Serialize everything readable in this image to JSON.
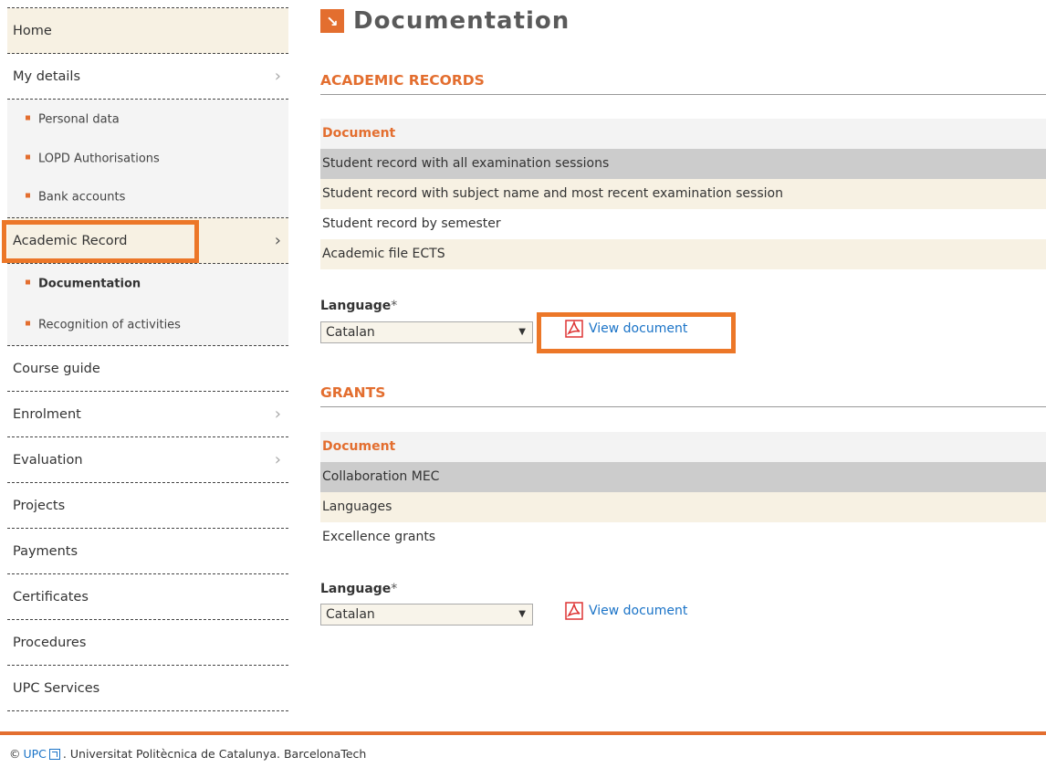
{
  "sidebar": {
    "items": [
      {
        "label": "Home"
      },
      {
        "label": "My details"
      },
      {
        "label": "Personal data"
      },
      {
        "label": "LOPD Authorisations"
      },
      {
        "label": "Bank accounts"
      },
      {
        "label": "Academic Record"
      },
      {
        "label": "Documentation"
      },
      {
        "label": "Recognition of activities"
      },
      {
        "label": "Course guide"
      },
      {
        "label": "Enrolment"
      },
      {
        "label": "Evaluation"
      },
      {
        "label": "Projects"
      },
      {
        "label": "Payments"
      },
      {
        "label": "Certificates"
      },
      {
        "label": "Procedures"
      },
      {
        "label": "UPC Services"
      }
    ]
  },
  "page": {
    "title": "Documentation",
    "title_icon": "arrow-down-right-icon"
  },
  "academic_records": {
    "heading": "ACADEMIC RECORDS",
    "column_header": "Document",
    "rows": [
      "Student record with all examination sessions",
      "Student record with subject name and most recent examination session",
      "Student record by semester",
      "Academic file ECTS"
    ],
    "language_label": "Language",
    "required_mark": "*",
    "language_value": "Catalan",
    "view_label": "View document"
  },
  "grants": {
    "heading": "GRANTS",
    "column_header": "Document",
    "rows": [
      "Collaboration MEC",
      "Languages",
      "Excellence grants"
    ],
    "language_label": "Language",
    "required_mark": "*",
    "language_value": "Catalan",
    "view_label": "View document"
  },
  "footer": {
    "copyright": "©",
    "link": "UPC",
    "text": ". Universitat Politècnica de Catalunya. BarcelonaTech"
  },
  "colors": {
    "accent": "#e36e2f",
    "highlight": "#ec7728",
    "link": "#1a73c7"
  }
}
